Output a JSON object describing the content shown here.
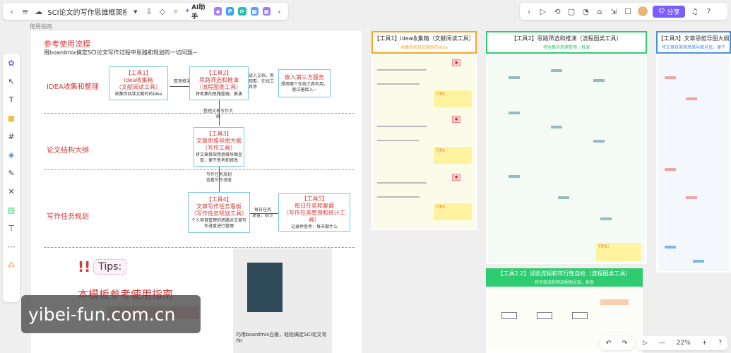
{
  "topbar": {
    "title": "SCI论文的写作思维框架模板",
    "ai_label": "AI助手",
    "share_label": "分享"
  },
  "tip_label": "使用指南",
  "main": {
    "title": "参考使用流程",
    "subtitle": "用boardmix搞定SCI论文写作过程中思路和规划的一切问题~",
    "rows": [
      {
        "label": "IDEA收集和整理"
      },
      {
        "label": "论文结构大纲"
      },
      {
        "label": "写作任务规划"
      }
    ],
    "boxes": {
      "tool1": {
        "title": "【工具1】",
        "name": "idea收集箱",
        "sub": "（文献阅读工具）",
        "desc": "收集你阅读文献时的idea"
      },
      "tool2": {
        "title": "【工具2】",
        "name": "思路筛选和推演",
        "sub": "（流程图类工具）",
        "desc": "将收集的思路整理、推演"
      },
      "third": {
        "title": "嵌入第三方服务",
        "desc": "想用哪个在线工具有用，就试着接入~"
      },
      "tool3": {
        "title": "【工具3】",
        "name": "文章思维导图大纲",
        "sub": "（写作工具）",
        "desc": "将文章骨架用思维导图呈现，便于思考和修改"
      },
      "tool4": {
        "title": "【工具4】",
        "name": "文章写作任务看板",
        "sub": "（写作任务规划工具）",
        "desc": "个人项目管理的思路对文章写作进度进行管理"
      },
      "tool5": {
        "title": "【工具5】",
        "name": "每日任务和复盘",
        "sub": "（写作任务管理和统计工具）",
        "desc": "记录并思考：每天做什么"
      }
    },
    "notes": {
      "n1": "整理推演",
      "n2": "嵌入文档、客观看、在线工具等",
      "n3": "整理文章写作大纲",
      "n4": "写作任务规划\n查看写作进度",
      "n5": "每日任务\n复盘、统计"
    },
    "tips_label": "Tips:",
    "tips_heading": "本模板参考使用指南",
    "thumb_caption": "巧用boardmix白板，轻松搞定SCI论文写作!"
  },
  "panels": {
    "p1": {
      "title": "【工具1】idea收集箱（文献阅读工具）",
      "sub": "收集你阅读文献时的idea",
      "tips": [
        "TIPS：",
        "TIPS：",
        "TIPS："
      ]
    },
    "p2": {
      "title": "【工具2】思路筛选和推演（流程图类工具）",
      "sub": "将收集的思路整理、推演",
      "tips": [
        "TIPS："
      ]
    },
    "p3": {
      "title": "【工具3】文章思维导图大纲",
      "sub": "将文章骨架用思维导图呈现，便于"
    },
    "p4": {
      "title": "【工具2.2】试验流程和可行性自检（流程图类工具）",
      "sub": "将实验流程用流程图呈现，检查"
    }
  },
  "zoom": {
    "value": "22%"
  },
  "watermark": "yibei-fun.com.cn"
}
